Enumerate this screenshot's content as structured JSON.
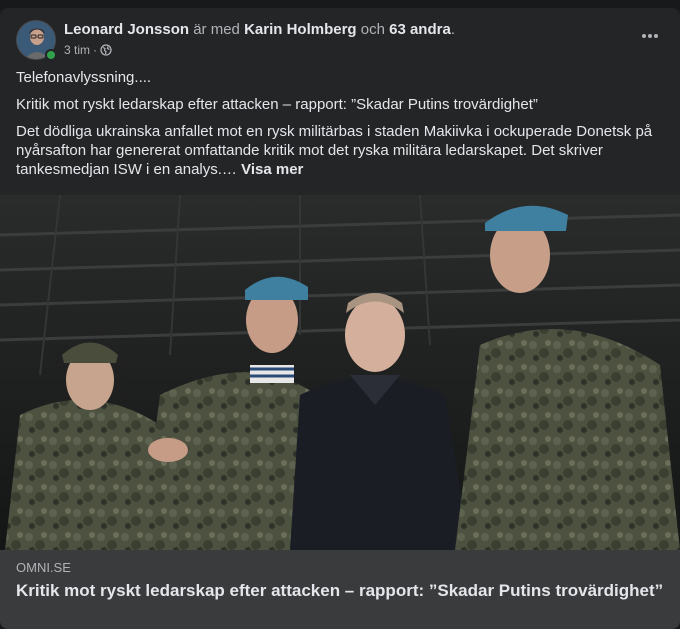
{
  "post": {
    "author": "Leonard Jonsson",
    "with_word": "är med",
    "tagged": "Karin Holmberg",
    "and_word": "och",
    "others": "63 andra",
    "period": ".",
    "time": "3 tim",
    "separator": "·",
    "privacy_icon": "public-globe-icon",
    "more_icon": "more-options-icon",
    "message": "Telefonavlyssning....",
    "quoted_title": "Kritik mot ryskt ledarskap efter attacken – rapport: ”Skadar Putins trovärdighet”",
    "quoted_body": "Det dödliga ukrainska anfallet mot en rysk militärbas i staden Makiivka i ockuperade Donetsk på nyårsafton har genererat omfattande kritik mot det ryska militära ledarskapet. Det skriver tankesmedjan ISW i en analys.… ",
    "see_more": "Visa mer"
  },
  "link_preview": {
    "domain": "OMNI.SE",
    "title": "Kritik mot ryskt ledarskap efter attacken – rapport: ”Skadar Putins trovärdighet”"
  },
  "colors": {
    "card_bg": "#242526",
    "footer_bg": "#3a3b3c",
    "online": "#31a24c"
  }
}
